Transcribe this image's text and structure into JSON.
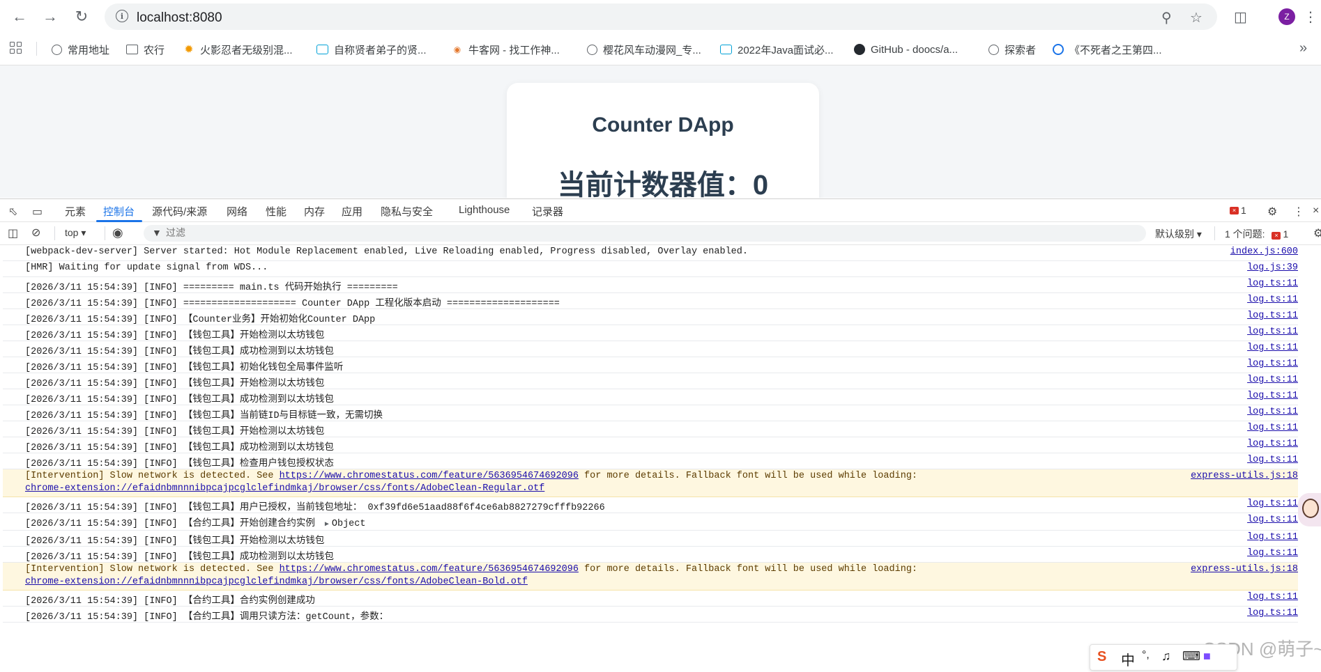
{
  "browser": {
    "url": "localhost:8080",
    "avatar_letter": "Z",
    "bookmarks": [
      {
        "label": "常用地址",
        "icon": "globe-icon"
      },
      {
        "label": "农行",
        "icon": "folder-icon"
      },
      {
        "label": "火影忍者无级别混...",
        "icon": "sun-icon"
      },
      {
        "label": "自称贤者弟子的贤...",
        "icon": "bilibili-icon"
      },
      {
        "label": "牛客网 - 找工作神...",
        "icon": "nowcoder-icon"
      },
      {
        "label": "樱花风车动漫网_专...",
        "icon": "globe-icon"
      },
      {
        "label": "2022年Java面试必...",
        "icon": "bilibili-icon"
      },
      {
        "label": "GitHub - doocs/a...",
        "icon": "github-icon"
      },
      {
        "label": "探索者",
        "icon": "globe-icon"
      },
      {
        "label": "《不死者之王第四...",
        "icon": "eye-icon"
      }
    ]
  },
  "page": {
    "title": "Counter DApp",
    "counter_text": "当前计数器值：0"
  },
  "devtools": {
    "tabs": [
      "元素",
      "控制台",
      "源代码/来源",
      "网络",
      "性能",
      "内存",
      "应用",
      "隐私与安全",
      "Lighthouse",
      "记录器"
    ],
    "active_tab": "控制台",
    "error_count": "1",
    "context": "top",
    "filter_placeholder": "过滤",
    "level": "默认级别",
    "issues_label": "1 个问题:",
    "issues_count": "1"
  },
  "console": {
    "rows": [
      {
        "msg": "[webpack-dev-server] Server started: Hot Module Replacement enabled, Live Reloading enabled, Progress disabled, Overlay enabled.",
        "src": "index.js:600"
      },
      {
        "msg": "[HMR] Waiting for update signal from WDS...",
        "src": "log.js:39"
      },
      {
        "msg": "[2026/3/11 15:54:39] [INFO] ========= main.ts 代码开始执行 =========",
        "src": "log.ts:11"
      },
      {
        "msg": "[2026/3/11 15:54:39] [INFO] ==================== Counter DApp 工程化版本启动 ====================",
        "src": "log.ts:11"
      },
      {
        "msg": "[2026/3/11 15:54:39] [INFO] 【Counter业务】开始初始化Counter DApp",
        "src": "log.ts:11"
      },
      {
        "msg": "[2026/3/11 15:54:39] [INFO] 【钱包工具】开始检测以太坊钱包",
        "src": "log.ts:11"
      },
      {
        "msg": "[2026/3/11 15:54:39] [INFO] 【钱包工具】成功检测到以太坊钱包",
        "src": "log.ts:11"
      },
      {
        "msg": "[2026/3/11 15:54:39] [INFO] 【钱包工具】初始化钱包全局事件监听",
        "src": "log.ts:11"
      },
      {
        "msg": "[2026/3/11 15:54:39] [INFO] 【钱包工具】开始检测以太坊钱包",
        "src": "log.ts:11"
      },
      {
        "msg": "[2026/3/11 15:54:39] [INFO] 【钱包工具】成功检测到以太坊钱包",
        "src": "log.ts:11"
      },
      {
        "msg": "[2026/3/11 15:54:39] [INFO] 【钱包工具】当前链ID与目标链一致，无需切换",
        "src": "log.ts:11"
      },
      {
        "msg": "[2026/3/11 15:54:39] [INFO] 【钱包工具】开始检测以太坊钱包",
        "src": "log.ts:11"
      },
      {
        "msg": "[2026/3/11 15:54:39] [INFO] 【钱包工具】成功检测到以太坊钱包",
        "src": "log.ts:11"
      },
      {
        "msg": "[2026/3/11 15:54:39] [INFO] 【钱包工具】检查用户钱包授权状态",
        "src": "log.ts:11"
      }
    ],
    "warn1": {
      "pre": "[Intervention] Slow network is detected. See ",
      "link": "https://www.chromestatus.com/feature/5636954674692096",
      "post": " for more details. Fallback font will be used while loading:",
      "line2": "chrome-extension://efaidnbmnnnibpcajpcglclefindmkaj/browser/css/fonts/AdobeClean-Regular.otf",
      "src": "express-utils.js:18"
    },
    "rows2": [
      {
        "msg": "[2026/3/11 15:54:39] [INFO] 【钱包工具】用户已授权，当前钱包地址： 0xf39fd6e51aad88f6f4ce6ab8827279cfffb92266",
        "src": "log.ts:11"
      }
    ],
    "object_row": {
      "msg": "[2026/3/11 15:54:39] [INFO] 【合约工具】开始创建合约实例",
      "obj": "Object",
      "src": "log.ts:11"
    },
    "rows3": [
      {
        "msg": "[2026/3/11 15:54:39] [INFO] 【钱包工具】开始检测以太坊钱包",
        "src": "log.ts:11"
      },
      {
        "msg": "[2026/3/11 15:54:39] [INFO] 【钱包工具】成功检测到以太坊钱包",
        "src": "log.ts:11"
      }
    ],
    "warn2": {
      "pre": "[Intervention] Slow network is detected. See ",
      "link": "https://www.chromestatus.com/feature/5636954674692096",
      "post": " for more details. Fallback font will be used while loading:",
      "line2": "chrome-extension://efaidnbmnnnibpcajpcglclefindmkaj/browser/css/fonts/AdobeClean-Bold.otf",
      "src": "express-utils.js:18"
    },
    "rows4": [
      {
        "msg": "[2026/3/11 15:54:39] [INFO] 【合约工具】合约实例创建成功",
        "src": "log.ts:11"
      },
      {
        "msg": "[2026/3/11 15:54:39] [INFO] 【合约工具】调用只读方法：getCount，参数：",
        "src": "log.ts:11"
      }
    ]
  },
  "overlay": {
    "watermark": "CSDN @萌子~~",
    "ime_lang": "中"
  }
}
